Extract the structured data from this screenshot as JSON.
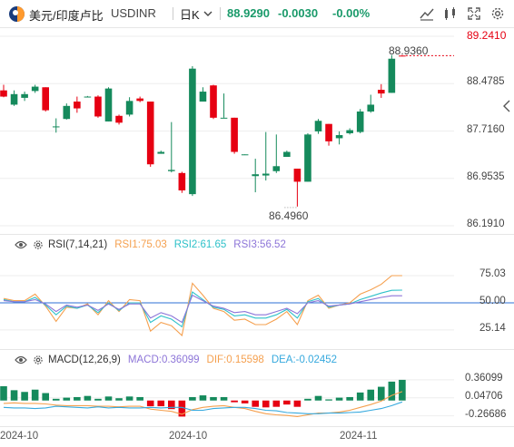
{
  "header": {
    "symbol_name": "美元/印度卢比",
    "symbol_code": "USDINR",
    "period": "日K",
    "last_price": "88.9290",
    "change": "-0.0030",
    "change_pct": "-0.00%"
  },
  "colors": {
    "up": "#158a5c",
    "down": "#e60012",
    "rsi1": "#f5a04f",
    "rsi2": "#2ec1c9",
    "rsi3": "#8d75d8",
    "macd_line": "#f5a04f",
    "dea_line": "#36a9de",
    "grid": "#eeeeee",
    "ref_line": "#2b6fd6"
  },
  "chart_data": [
    {
      "type": "candlestick",
      "title": "USDINR 日K",
      "y_ticks": [
        "89.2410",
        "88.4785",
        "87.7160",
        "86.9535",
        "86.1910"
      ],
      "ylim": [
        86.191,
        89.241
      ],
      "price_tag": "89.2410",
      "annotations": {
        "high": "88.9360",
        "low": "86.4960"
      },
      "candles": [
        {
          "o": 88.37,
          "h": 88.46,
          "l": 88.26,
          "c": 88.27
        },
        {
          "o": 88.14,
          "h": 88.37,
          "l": 88.12,
          "c": 88.31
        },
        {
          "o": 88.25,
          "h": 88.35,
          "l": 88.2,
          "c": 88.31
        },
        {
          "o": 88.36,
          "h": 88.46,
          "l": 88.33,
          "c": 88.43
        },
        {
          "o": 88.42,
          "h": 88.42,
          "l": 88.03,
          "c": 88.05
        },
        {
          "o": 87.79,
          "h": 87.92,
          "l": 87.69,
          "c": 87.79
        },
        {
          "o": 87.91,
          "h": 88.16,
          "l": 87.9,
          "c": 88.12
        },
        {
          "o": 88.19,
          "h": 88.27,
          "l": 88.01,
          "c": 88.08
        },
        {
          "o": 88.26,
          "h": 88.28,
          "l": 88.26,
          "c": 88.27
        },
        {
          "o": 88.27,
          "h": 88.29,
          "l": 87.93,
          "c": 87.95
        },
        {
          "o": 87.87,
          "h": 88.42,
          "l": 87.87,
          "c": 88.4
        },
        {
          "o": 87.96,
          "h": 87.98,
          "l": 87.82,
          "c": 87.85
        },
        {
          "o": 87.98,
          "h": 88.26,
          "l": 87.95,
          "c": 88.2
        },
        {
          "o": 88.24,
          "h": 88.27,
          "l": 88.18,
          "c": 88.2
        },
        {
          "o": 88.19,
          "h": 88.19,
          "l": 87.14,
          "c": 87.18
        },
        {
          "o": 87.35,
          "h": 87.4,
          "l": 87.35,
          "c": 87.38
        },
        {
          "o": 87.07,
          "h": 87.86,
          "l": 87.05,
          "c": 87.09
        },
        {
          "o": 87.04,
          "h": 87.06,
          "l": 86.72,
          "c": 86.76
        },
        {
          "o": 86.7,
          "h": 88.76,
          "l": 86.67,
          "c": 88.72
        },
        {
          "o": 88.19,
          "h": 88.42,
          "l": 88.19,
          "c": 88.35
        },
        {
          "o": 88.45,
          "h": 88.46,
          "l": 87.91,
          "c": 87.93
        },
        {
          "o": 87.93,
          "h": 88.32,
          "l": 87.93,
          "c": 87.93
        },
        {
          "o": 87.93,
          "h": 87.93,
          "l": 87.35,
          "c": 87.38
        },
        {
          "o": 87.34,
          "h": 87.34,
          "l": 87.33,
          "c": 87.34
        },
        {
          "o": 86.99,
          "h": 87.27,
          "l": 86.73,
          "c": 87.02
        },
        {
          "o": 87.0,
          "h": 87.7,
          "l": 86.92,
          "c": 87.03
        },
        {
          "o": 87.07,
          "h": 87.66,
          "l": 87.04,
          "c": 87.15
        },
        {
          "o": 87.3,
          "h": 87.4,
          "l": 87.3,
          "c": 87.38
        },
        {
          "o": 87.11,
          "h": 87.11,
          "l": 86.5,
          "c": 86.9
        },
        {
          "o": 86.9,
          "h": 87.68,
          "l": 86.9,
          "c": 87.66
        },
        {
          "o": 87.71,
          "h": 87.91,
          "l": 87.67,
          "c": 87.88
        },
        {
          "o": 87.83,
          "h": 87.83,
          "l": 87.48,
          "c": 87.55
        },
        {
          "o": 87.6,
          "h": 87.71,
          "l": 87.5,
          "c": 87.65
        },
        {
          "o": 87.68,
          "h": 87.76,
          "l": 87.66,
          "c": 87.73
        },
        {
          "o": 87.7,
          "h": 88.07,
          "l": 87.68,
          "c": 88.03
        },
        {
          "o": 88.03,
          "h": 88.3,
          "l": 88.01,
          "c": 88.14
        },
        {
          "o": 88.38,
          "h": 88.47,
          "l": 88.25,
          "c": 88.32
        },
        {
          "o": 88.33,
          "h": 88.94,
          "l": 88.33,
          "c": 88.88
        },
        {
          "o": 88.93,
          "h": 88.94,
          "l": 88.92,
          "c": 88.929
        }
      ]
    },
    {
      "type": "line",
      "title": "RSI(7,14,21)",
      "y_ticks": [
        "75.03",
        "50.00",
        "25.14"
      ],
      "ylim": [
        10,
        95
      ],
      "reference": 50,
      "series": [
        {
          "name": "RSI1:75.03",
          "values": [
            54,
            52,
            52,
            58,
            47,
            33,
            46,
            45,
            49,
            39,
            52,
            42,
            53,
            52,
            24,
            32,
            29,
            20,
            68,
            57,
            45,
            42,
            34,
            35,
            30,
            30,
            35,
            42,
            30,
            52,
            57,
            45,
            48,
            50,
            58,
            62,
            67,
            75,
            75.03
          ]
        },
        {
          "name": "RSI2:61.65",
          "values": [
            53,
            51,
            51,
            55,
            48,
            39,
            47,
            45,
            48,
            41,
            50,
            43,
            50,
            50,
            32,
            38,
            35,
            28,
            60,
            53,
            46,
            44,
            38,
            39,
            36,
            36,
            39,
            44,
            36,
            51,
            54,
            46,
            48,
            49,
            53,
            56,
            59,
            61.5,
            61.65
          ]
        },
        {
          "name": "RSI3:56.52",
          "values": [
            52,
            51,
            51,
            53,
            49,
            42,
            48,
            46,
            48,
            43,
            49,
            44,
            49,
            49,
            36,
            41,
            38,
            32,
            57,
            52,
            47,
            45,
            41,
            42,
            39,
            39,
            42,
            45,
            40,
            50,
            52,
            47,
            48,
            49,
            51,
            53,
            55,
            56.5,
            56.52
          ]
        }
      ]
    },
    {
      "type": "bar",
      "title": "MACD(12,26,9)",
      "y_ticks": [
        "0.36099",
        "0.04706",
        "-0.26686"
      ],
      "ylim": [
        -0.4,
        0.55
      ],
      "series": [
        {
          "name": "MACD:0.36099",
          "values": [
            0.25,
            0.18,
            0.15,
            0.19,
            0.13,
            0.03,
            0.05,
            0.06,
            0.08,
            0.03,
            0.07,
            0.04,
            0.07,
            0.06,
            -0.1,
            -0.1,
            -0.15,
            -0.28,
            0.06,
            0.09,
            0.06,
            0.06,
            -0.03,
            -0.05,
            -0.11,
            -0.12,
            -0.11,
            -0.07,
            -0.11,
            0.03,
            0.08,
            0.02,
            0.05,
            0.06,
            0.14,
            0.19,
            0.24,
            0.33,
            0.36099
          ]
        },
        {
          "name": "DIF:0.15598",
          "values": [
            -0.05,
            -0.04,
            -0.05,
            -0.05,
            -0.06,
            -0.08,
            -0.09,
            -0.09,
            -0.09,
            -0.1,
            -0.1,
            -0.11,
            -0.1,
            -0.1,
            -0.15,
            -0.17,
            -0.19,
            -0.24,
            -0.16,
            -0.12,
            -0.1,
            -0.09,
            -0.12,
            -0.14,
            -0.19,
            -0.23,
            -0.25,
            -0.26,
            -0.28,
            -0.25,
            -0.22,
            -0.22,
            -0.2,
            -0.17,
            -0.12,
            -0.07,
            -0.01,
            0.09,
            0.15598
          ]
        },
        {
          "name": "DEA:-0.02452",
          "values": [
            -0.12,
            -0.13,
            -0.13,
            -0.14,
            -0.13,
            -0.1,
            -0.11,
            -0.12,
            -0.13,
            -0.11,
            -0.13,
            -0.12,
            -0.13,
            -0.13,
            -0.12,
            -0.13,
            -0.12,
            -0.12,
            -0.17,
            -0.17,
            -0.14,
            -0.13,
            -0.12,
            -0.12,
            -0.14,
            -0.17,
            -0.18,
            -0.21,
            -0.22,
            -0.23,
            -0.23,
            -0.22,
            -0.22,
            -0.21,
            -0.2,
            -0.17,
            -0.14,
            -0.09,
            -0.02452
          ]
        }
      ]
    }
  ],
  "x_labels": [
    "2024-10",
    "2024-10",
    "2024-11"
  ]
}
